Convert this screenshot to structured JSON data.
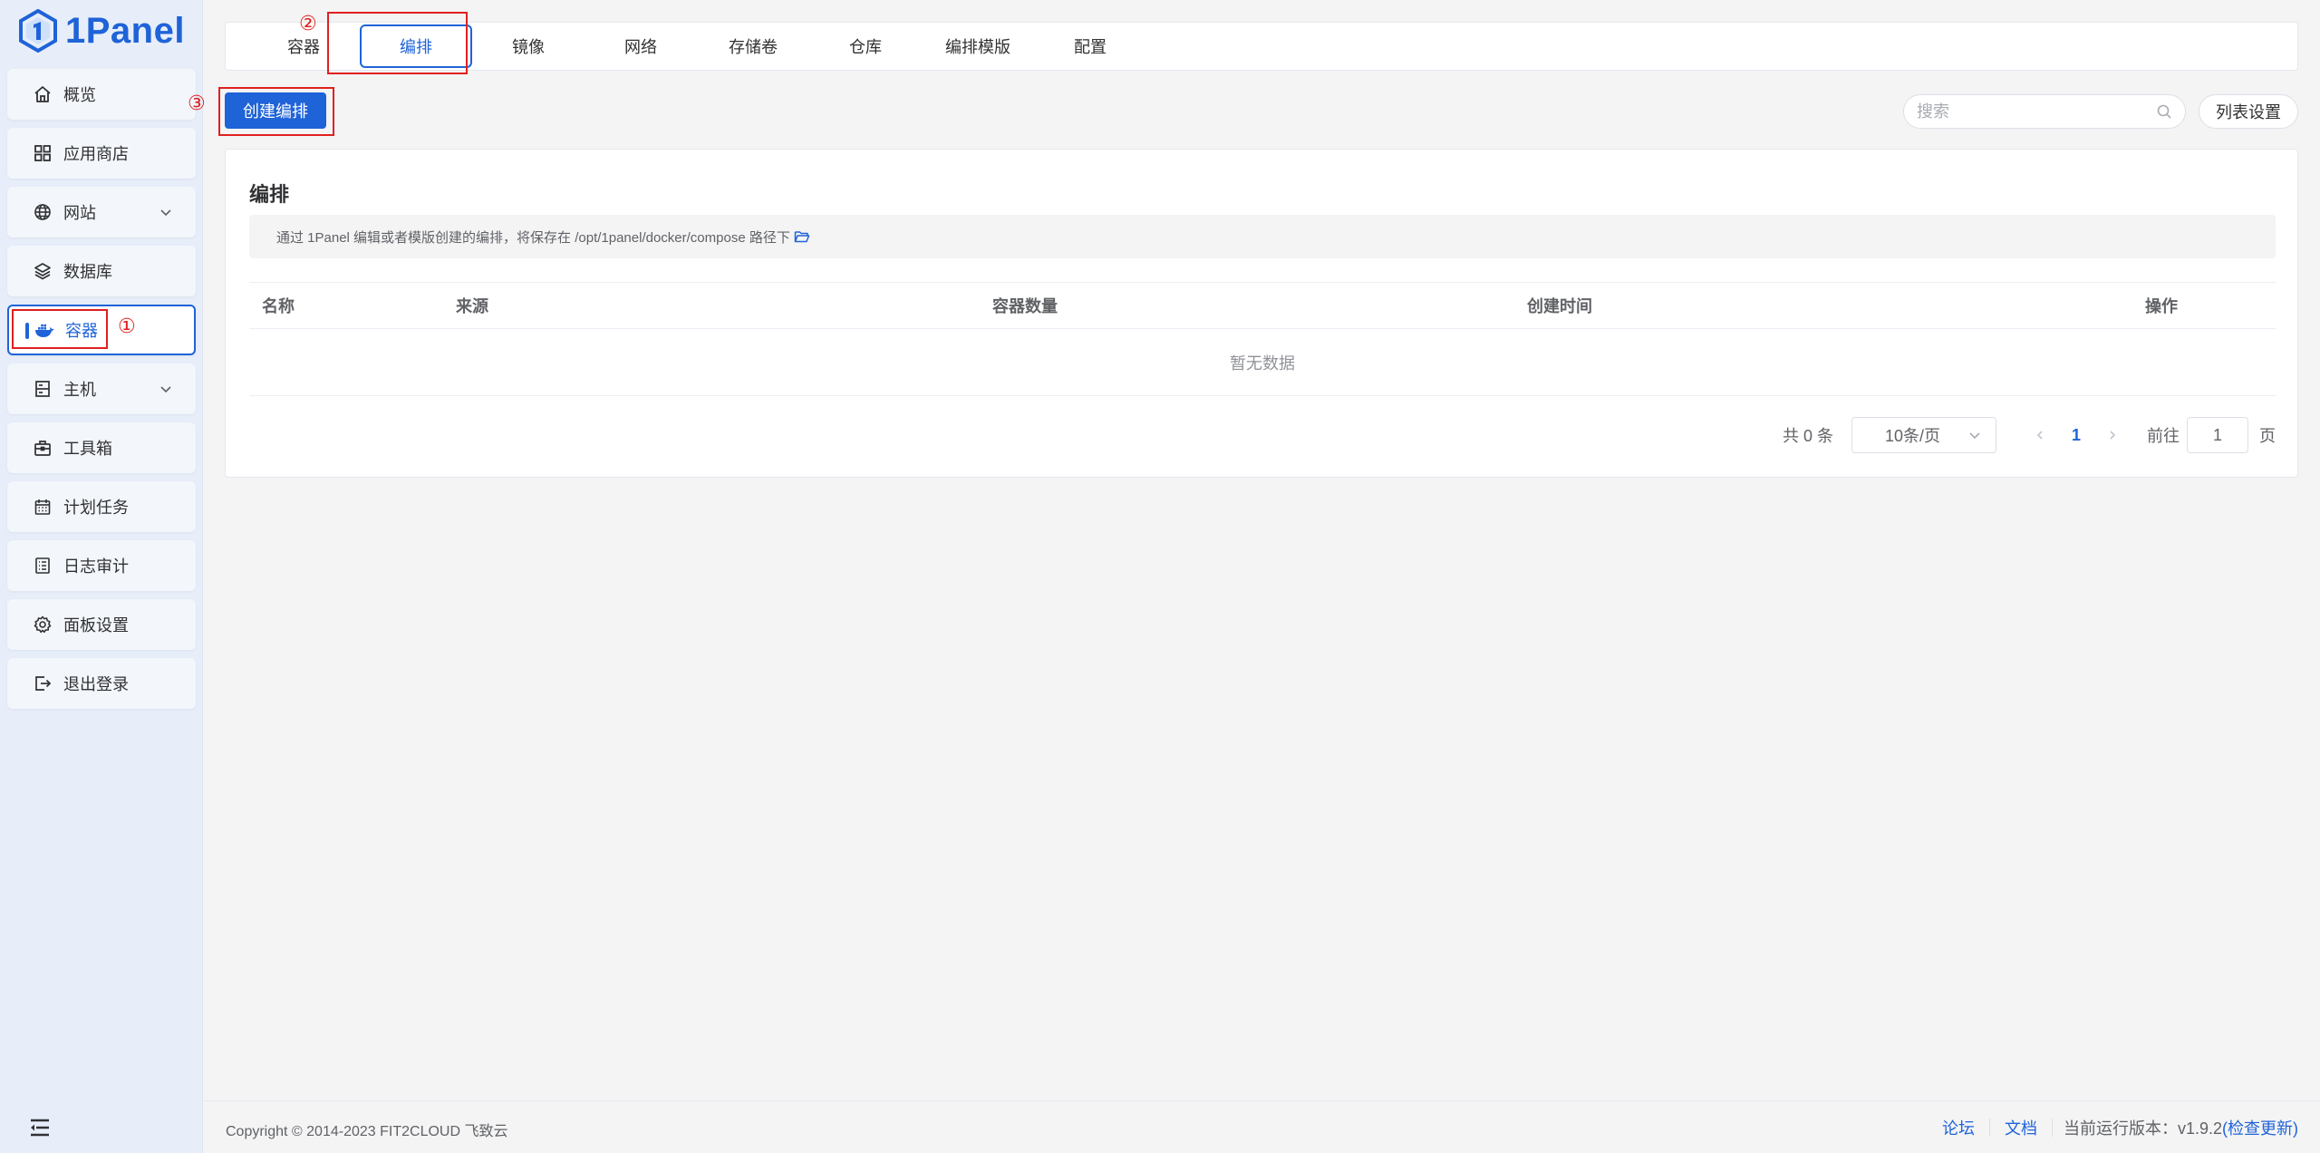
{
  "app": {
    "logo_text": "1Panel"
  },
  "sidebar": {
    "items": [
      {
        "label": "概览",
        "icon": "home-icon"
      },
      {
        "label": "应用商店",
        "icon": "grid-icon"
      },
      {
        "label": "网站",
        "icon": "globe-icon",
        "has_children": true
      },
      {
        "label": "数据库",
        "icon": "layers-icon"
      },
      {
        "label": "容器",
        "icon": "docker-icon",
        "active": true
      },
      {
        "label": "主机",
        "icon": "server-icon",
        "has_children": true
      },
      {
        "label": "工具箱",
        "icon": "toolbox-icon"
      },
      {
        "label": "计划任务",
        "icon": "calendar-icon"
      },
      {
        "label": "日志审计",
        "icon": "log-icon"
      },
      {
        "label": "面板设置",
        "icon": "gear-icon"
      },
      {
        "label": "退出登录",
        "icon": "logout-icon"
      }
    ]
  },
  "annotations": {
    "step1": "①",
    "step2": "②",
    "step3": "③"
  },
  "tabs": [
    {
      "label": "容器"
    },
    {
      "label": "编排",
      "active": true
    },
    {
      "label": "镜像"
    },
    {
      "label": "网络"
    },
    {
      "label": "存储卷"
    },
    {
      "label": "仓库"
    },
    {
      "label": "编排模版"
    },
    {
      "label": "配置"
    }
  ],
  "toolbar": {
    "create_label": "创建编排",
    "search_placeholder": "搜索",
    "list_settings_label": "列表设置"
  },
  "card": {
    "title": "编排",
    "notice": "通过 1Panel 编辑或者模版创建的编排，将保存在 /opt/1panel/docker/compose 路径下",
    "columns": [
      "名称",
      "来源",
      "容器数量",
      "创建时间",
      "操作"
    ],
    "empty_text": "暂无数据"
  },
  "pagination": {
    "total": "共 0 条",
    "page_size": "10条/页",
    "current_page": "1",
    "goto_label": "前往",
    "goto_value": "1",
    "page_suffix": "页"
  },
  "footer": {
    "copyright": "Copyright © 2014-2023 FIT2CLOUD 飞致云",
    "forum": "论坛",
    "docs": "文档",
    "version": "当前运行版本：v1.9.2",
    "check_update": "(检查更新)"
  },
  "colors": {
    "accent": "#1f63d8",
    "annotation": "#e0201f",
    "sidebar_bg": "#e7eef9"
  }
}
